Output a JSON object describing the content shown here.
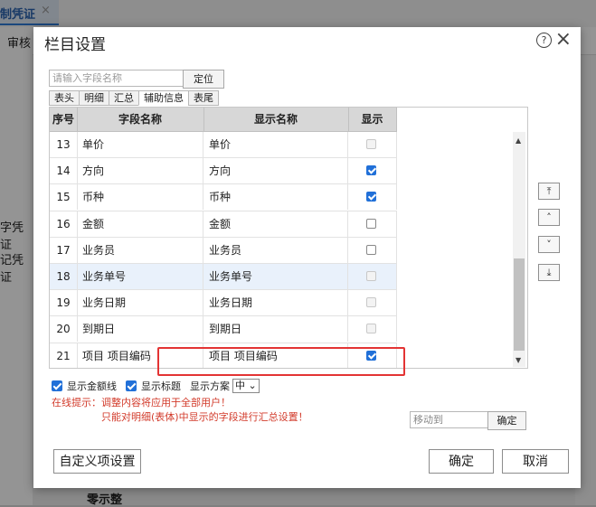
{
  "background": {
    "tab_label": "制凭证",
    "tab_close": "×",
    "strip_label": "审核",
    "left_labels": [
      "字凭证",
      "记凭证"
    ],
    "bottom_label": "零示整"
  },
  "dialog": {
    "title": "栏目设置",
    "help_icon": "?",
    "close_icon": "×",
    "search": {
      "placeholder": "请输入字段名称",
      "value": ""
    },
    "locate_label": "定位",
    "tabs": [
      {
        "label": "表头",
        "active": false
      },
      {
        "label": "明细",
        "active": false
      },
      {
        "label": "汇总",
        "active": false
      },
      {
        "label": "辅助信息",
        "active": true
      },
      {
        "label": "表尾",
        "active": false
      }
    ],
    "columns": {
      "seq": "序号",
      "field": "字段名称",
      "display": "显示名称",
      "show": "显示"
    },
    "rows": [
      {
        "seq": "13",
        "field": "单价",
        "display": "单价",
        "show": "disabled",
        "highlight": false
      },
      {
        "seq": "14",
        "field": "方向",
        "display": "方向",
        "show": "checked",
        "highlight": false
      },
      {
        "seq": "15",
        "field": "币种",
        "display": "币种",
        "show": "checked",
        "highlight": false
      },
      {
        "seq": "16",
        "field": "金额",
        "display": "金额",
        "show": "unchecked",
        "highlight": false
      },
      {
        "seq": "17",
        "field": "业务员",
        "display": "业务员",
        "show": "unchecked",
        "highlight": false
      },
      {
        "seq": "18",
        "field": "业务单号",
        "display": "业务单号",
        "show": "disabled",
        "highlight": true
      },
      {
        "seq": "19",
        "field": "业务日期",
        "display": "业务日期",
        "show": "disabled",
        "highlight": false
      },
      {
        "seq": "20",
        "field": "到期日",
        "display": "到期日",
        "show": "disabled",
        "highlight": false
      },
      {
        "seq": "21",
        "field": "项目 项目编码",
        "display": "项目 项目编码",
        "show": "checked",
        "highlight": false
      }
    ],
    "move_buttons": [
      {
        "name": "move-top-button",
        "glyph": "⤒"
      },
      {
        "name": "move-up-button",
        "glyph": "˄"
      },
      {
        "name": "move-down-button",
        "glyph": "˅"
      },
      {
        "name": "move-bottom-button",
        "glyph": "⤓"
      }
    ],
    "options": {
      "show_amount_line": "显示金额线",
      "show_title": "显示标题",
      "scheme_label": "显示方案",
      "scheme_value": "中 ⌄"
    },
    "tip_line1": "在线提示：调整内容将应用于全部用户！",
    "tip_line2": "只能对明细(表体)中显示的字段进行汇总设置！",
    "move_to": {
      "placeholder": "移动到",
      "value": ""
    },
    "move_confirm_label": "确定",
    "custom_items_label": "自定义项设置",
    "ok_label": "确定",
    "cancel_label": "取消"
  },
  "colors": {
    "accent": "#2170d8",
    "tip_red": "#d23a2a",
    "highlight_box": "#e33434",
    "header_bg": "#d7d7d7"
  }
}
